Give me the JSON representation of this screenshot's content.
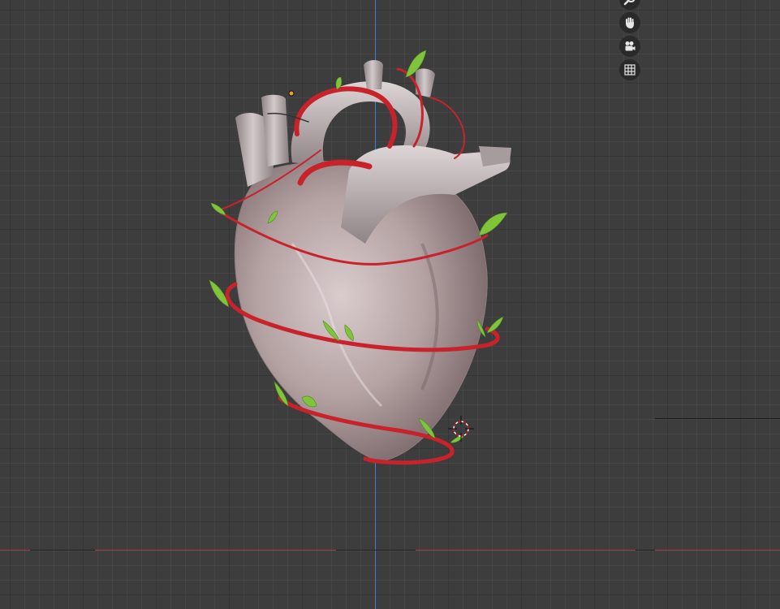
{
  "viewport": {
    "background": "#3d3d3d",
    "grid_major": "#303030",
    "axis_x_color": "#9a3b45",
    "axis_y_color": "#3f7fd0"
  },
  "navigation_gizmo": {
    "buttons": [
      {
        "name": "zoom",
        "icon": "magnifier-icon"
      },
      {
        "name": "pan",
        "icon": "hand-icon"
      },
      {
        "name": "camera",
        "icon": "camera-icon"
      },
      {
        "name": "toggle-view",
        "icon": "grid-icon"
      }
    ]
  },
  "scene": {
    "object": "heart-model",
    "vessel_color": "#c8222a",
    "leaf_color": "#7fc43a",
    "heart_color": "#b9a8a8",
    "cursor": "3d-cursor"
  }
}
